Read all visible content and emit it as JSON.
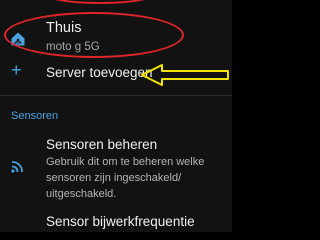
{
  "server": {
    "name": "Thuis",
    "device": "moto g 5G",
    "icon": "home-assistant-icon"
  },
  "add_server": {
    "label": "Server toevoegen",
    "icon": "plus-icon"
  },
  "sensors_section": {
    "header": "Sensoren",
    "items": [
      {
        "title": "Sensoren beheren",
        "description": "Gebruik dit om te beheren welke sensoren zijn ingeschakeld/ uitgeschakeld.",
        "icon": "wifi-signal-icon"
      },
      {
        "title": "Sensor bijwerkfrequentie"
      }
    ]
  },
  "colors": {
    "background": "#121212",
    "accent": "#4aa3df",
    "annotation_red": "#e0262a",
    "annotation_yellow": "#f2e600"
  }
}
